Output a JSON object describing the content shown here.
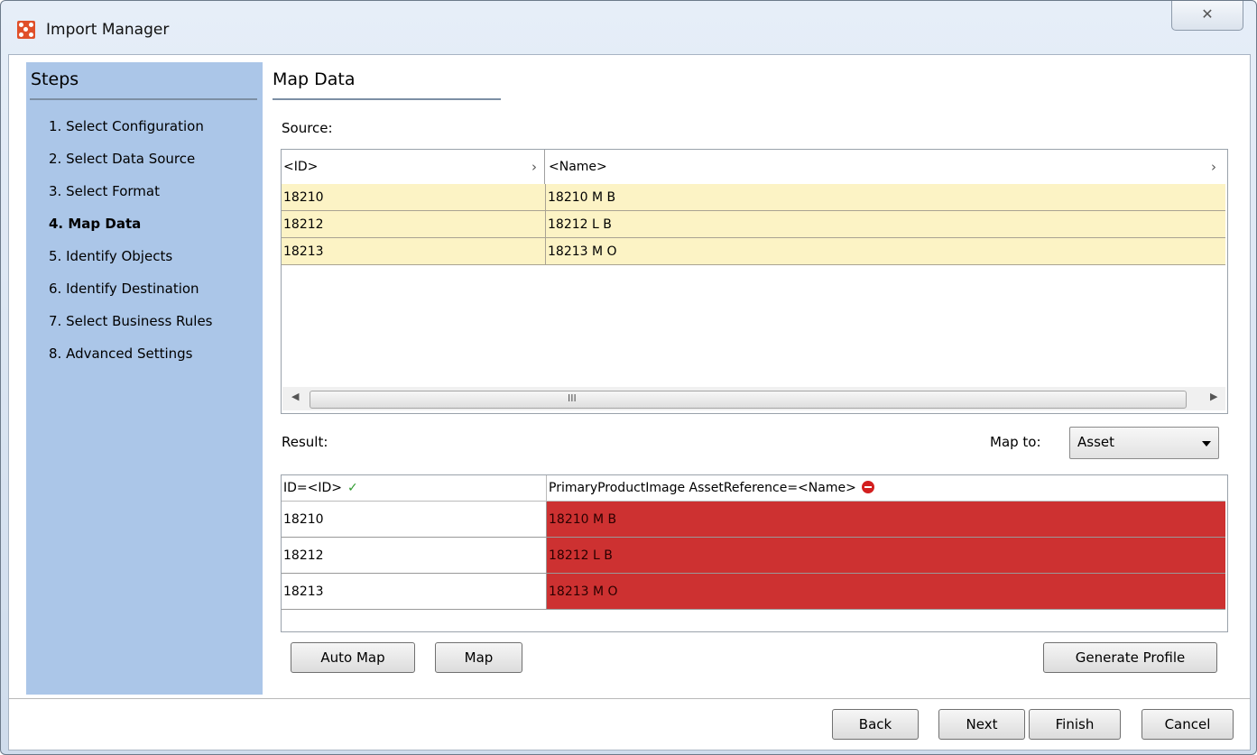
{
  "window": {
    "title": "Import Manager",
    "close_glyph": "✕",
    "icon": "import-manager-app-icon"
  },
  "sidebar": {
    "title": "Steps",
    "items": [
      {
        "label": "1. Select Configuration",
        "active": false
      },
      {
        "label": "2. Select Data Source",
        "active": false
      },
      {
        "label": "3. Select Format",
        "active": false
      },
      {
        "label": "4. Map Data",
        "active": true
      },
      {
        "label": "5. Identify Objects",
        "active": false
      },
      {
        "label": "6. Identify Destination",
        "active": false
      },
      {
        "label": "7. Select Business Rules",
        "active": false
      },
      {
        "label": "8. Advanced Settings",
        "active": false
      }
    ]
  },
  "main": {
    "title": "Map Data",
    "source_label": "Source:",
    "source": {
      "columns": [
        "<ID>",
        "<Name>"
      ],
      "rows": [
        [
          "18210",
          "18210 M B"
        ],
        [
          "18212",
          "18212 L B"
        ],
        [
          "18213",
          "18213 M O"
        ]
      ],
      "scroll_grip": "III"
    },
    "result_label": "Result:",
    "map_to_label": "Map to:",
    "map_to_value": "Asset",
    "result": {
      "columns": [
        {
          "label": "ID=<ID>",
          "status": "valid"
        },
        {
          "label": "PrimaryProductImage AssetReference=<Name>",
          "status": "error"
        }
      ],
      "rows": [
        [
          "18210",
          "18210 M B"
        ],
        [
          "18212",
          "18212 L B"
        ],
        [
          "18213",
          "18213 M O"
        ]
      ]
    },
    "buttons": {
      "auto_map": "Auto Map",
      "map": "Map",
      "generate_profile": "Generate Profile"
    }
  },
  "footer": {
    "back": "Back",
    "next": "Next",
    "finish": "Finish",
    "cancel": "Cancel"
  },
  "colors": {
    "sidebar_bg": "#abc6e8",
    "source_row_bg": "#fcf3c5",
    "error_cell_bg": "#cd3131",
    "valid_check": "#2f9b2f"
  }
}
